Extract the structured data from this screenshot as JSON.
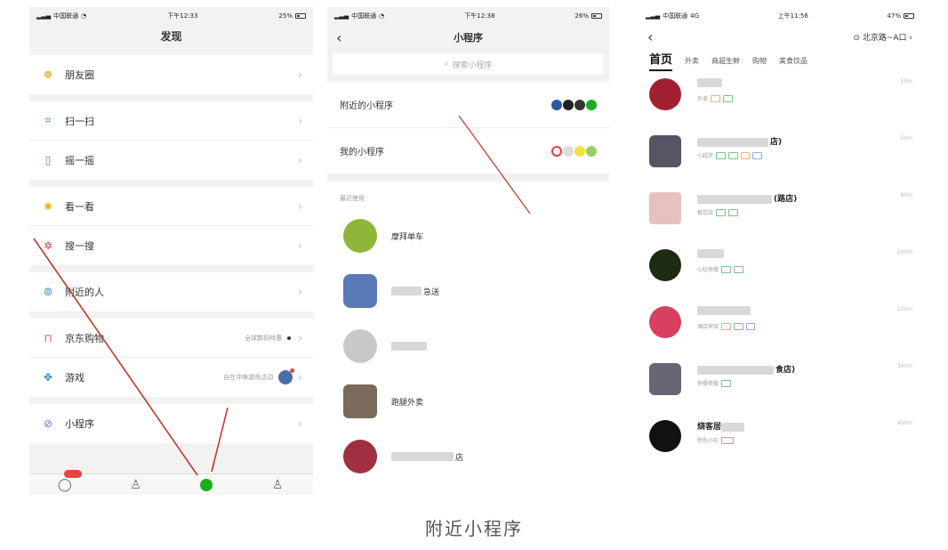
{
  "colors": {
    "wechat_green": "#1aad19",
    "annotation_red": "#c0392b",
    "badge_red": "#e64340"
  },
  "phone1": {
    "status": {
      "carrier": "中国联通",
      "time": "下午12:33",
      "battery": "25%"
    },
    "title": "发现",
    "groups": [
      [
        {
          "icon": "moments-icon",
          "label": "朋友圈"
        }
      ],
      [
        {
          "icon": "scan-icon",
          "label": "扫一扫"
        },
        {
          "icon": "shake-icon",
          "label": "摇一摇"
        }
      ],
      [
        {
          "icon": "top-stories-icon",
          "label": "看一看"
        },
        {
          "icon": "search-icon",
          "label": "搜一搜"
        }
      ],
      [
        {
          "icon": "people-nearby-icon",
          "label": "附近的人"
        }
      ],
      [
        {
          "icon": "shopping-icon",
          "label": "京东购物",
          "extra": "全球数码特惠"
        },
        {
          "icon": "games-icon",
          "label": "游戏",
          "extra": "自在冲锋游戏活动"
        }
      ],
      [
        {
          "icon": "miniprogram-icon",
          "label": "小程序"
        }
      ]
    ]
  },
  "phone2": {
    "status": {
      "carrier": "中国联通",
      "time": "下午12:38",
      "battery": "26%"
    },
    "title": "小程序",
    "search_placeholder": "搜索小程序",
    "rows": [
      {
        "label": "附近的小程序"
      },
      {
        "label": "我的小程序"
      }
    ],
    "recent_label": "最近使用",
    "apps": [
      {
        "name": "摩拜单车"
      },
      {
        "name": "急送"
      },
      {
        "name": ""
      },
      {
        "name": "跑腿外卖"
      },
      {
        "name": "店"
      }
    ]
  },
  "phone3": {
    "status": {
      "carrier": "中国联通",
      "network": "4G",
      "time": "上午11:56",
      "battery": "47%"
    },
    "location": "北京路~A口",
    "categories": [
      "首页",
      "外卖",
      "商超生鲜",
      "购物",
      "美食饮品"
    ],
    "shops": [
      {
        "name": "",
        "sub": "外卖",
        "distance": "10m"
      },
      {
        "name": "店)",
        "sub": "小超市",
        "distance": "50m"
      },
      {
        "name": "(路店)",
        "sub": "餐饮店",
        "distance": "80m"
      },
      {
        "name": "",
        "sub": "小吃快餐",
        "distance": "200m"
      },
      {
        "name": "",
        "sub": "酒店宾馆",
        "distance": "220m"
      },
      {
        "name": "食店)",
        "sub": "快餐简餐",
        "distance": "340m"
      },
      {
        "name": "烧客居",
        "sub": "特色小吃",
        "distance": "450m"
      }
    ]
  },
  "caption": "附近小程序"
}
